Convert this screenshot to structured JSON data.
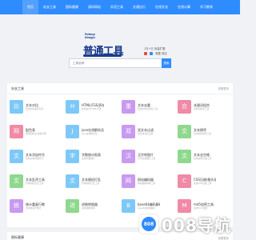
{
  "nav": {
    "items": [
      "首页",
      "站长工具",
      "图标健康",
      "源码网站",
      "实用工具",
      "交通出行",
      "在线文化",
      "在线计算",
      "学习教育"
    ]
  },
  "logo": {
    "small_text": "Putong\nGongju",
    "main_text": "普通工具"
  },
  "extension": {
    "line1": "1万+已 安装扩展",
    "line2": "收藏 商店"
  },
  "search": {
    "placeholder": "工具名称",
    "button_label": "搜索"
  },
  "panel": {
    "title": "站长工具",
    "more": "查看更多"
  },
  "panel2": {
    "title": "图标健康",
    "more": "查看更多"
  },
  "tools": [
    [
      {
        "char": "比",
        "color": "#7ec8f8",
        "title": "文本对比",
        "desc": "在线文本差异对比"
      },
      {
        "char": "H",
        "color": "#7ec8f8",
        "title": "HTML/CSS/JS在线运...",
        "desc": "在线运行HTML代码"
      },
      {
        "char": "重",
        "color": "#c89af0",
        "title": "文本去重",
        "desc": "在线文本去重复工具"
      },
      {
        "char": "合",
        "color": "#f08aa6",
        "title": "关键词组合",
        "desc": "关键词组合工具"
      }
    ],
    [
      {
        "char": "网",
        "color": "#f08aa6",
        "title": "配色表",
        "desc": "网页配色表 颜色代码"
      },
      {
        "char": "J",
        "color": "#7ec8f8",
        "title": "json在线解析及格式化",
        "desc": "json在线格式化"
      },
      {
        "char": "双",
        "color": "#c89af0",
        "title": "双文本过滤",
        "desc": "双文本对比过滤"
      },
      {
        "char": "文",
        "color": "#8fd88f",
        "title": "文本倒序",
        "desc": "文本倒序排列工具"
      }
    ],
    [
      {
        "char": "文",
        "color": "#7ec8f8",
        "title": "文本添加符号",
        "desc": "在线文本添加符号"
      },
      {
        "char": "字",
        "color": "#7ec8f8",
        "title": "字数统计报表",
        "desc": "在线字数统计"
      },
      {
        "char": "汉",
        "color": "#c89af0",
        "title": "汉字转图片",
        "desc": "汉字生成图片工具"
      },
      {
        "char": "文",
        "color": "#8fd88f",
        "title": "文本去空格",
        "desc": "在线去除空格工具"
      }
    ],
    [
      {
        "char": "文",
        "color": "#8fd88f",
        "title": "文本乱序工具",
        "desc": "文本随机乱序工具"
      },
      {
        "char": "文",
        "color": "#7ec8f8",
        "title": "文本随机打乱",
        "desc": "文本随机打乱工具"
      },
      {
        "char": "网",
        "color": "#c89af0",
        "title": "网站编码器",
        "desc": "网站编码转换工具"
      },
      {
        "char": "C",
        "color": "#f08aa6",
        "title": "CSS压缩/格式化",
        "desc": "在线CSS压缩工具"
      }
    ],
    [
      {
        "char": "统",
        "color": "#c89af0",
        "title": "统计重复行数",
        "desc": "文本重复行统计"
      },
      {
        "char": "进",
        "color": "#8fd88f",
        "title": "进制转换器",
        "desc": "在线进制转换"
      },
      {
        "char": "B",
        "color": "#7ec8f8",
        "title": "base64编码解码",
        "desc": "base64在线编码"
      },
      {
        "char": "M",
        "color": "#f08aa6",
        "title": "md5加密工具",
        "desc": "在线md5加密"
      }
    ]
  ],
  "watermark": {
    "badge": "808",
    "text": "008导航"
  }
}
